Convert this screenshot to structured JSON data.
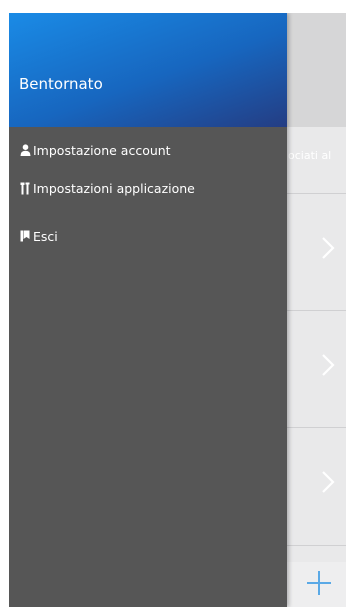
{
  "background": {
    "partial_text": "ociati al",
    "rows": [
      {
        "icon": "chevron-right-icon"
      },
      {
        "icon": "chevron-right-icon"
      },
      {
        "icon": "chevron-right-icon"
      }
    ],
    "fab_icon": "plus-icon"
  },
  "drawer": {
    "title": "Bentornato",
    "items": [
      {
        "label": "Impostazione account",
        "icon": "user-icon"
      },
      {
        "label": "Impostazioni applicazione",
        "icon": "tools-icon"
      },
      {
        "label": "Esci",
        "icon": "book-icon"
      }
    ]
  },
  "colors": {
    "drawer_bg": "#565656",
    "header_gradient_start": "#1a8be6",
    "header_gradient_end": "#243d83",
    "accent_plus": "#5aa9e6"
  }
}
